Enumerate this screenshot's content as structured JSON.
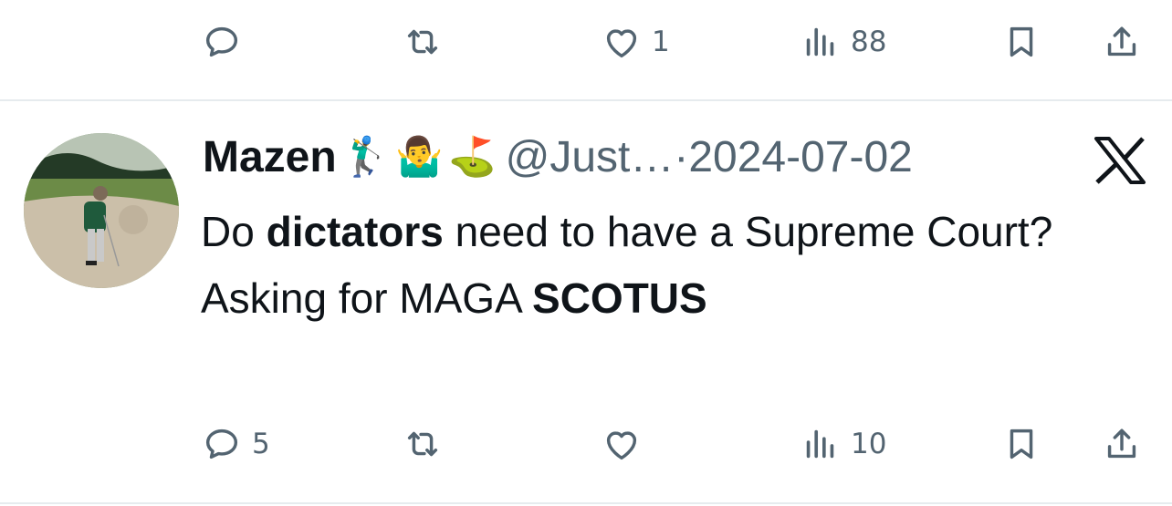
{
  "top_actions": {
    "reply_count": "",
    "retweet_count": "",
    "like_count": "1",
    "views_count": "88"
  },
  "tweet": {
    "author_name": "Mazen",
    "name_emojis": [
      "🏌️‍♂️",
      "🤷‍♂️",
      "⛳"
    ],
    "handle": "@Just…",
    "separator": "·",
    "date": "2024-07-02",
    "text": {
      "p1_before": "Do ",
      "p1_bold": "dictators",
      "p1_after": " need to have a Supreme Court?",
      "p2_before": "Asking for MAGA ",
      "p2_bold": "SCOTUS"
    },
    "actions": {
      "reply_count": "5",
      "retweet_count": "",
      "like_count": "",
      "views_count": "10"
    }
  },
  "icons": {
    "reply": "reply-icon",
    "retweet": "retweet-icon",
    "like": "heart-icon",
    "views": "views-icon",
    "bookmark": "bookmark-icon",
    "share": "share-icon",
    "platform": "x-logo-icon"
  },
  "colors": {
    "text": "#0f1419",
    "muted": "#536471",
    "divider": "#e6ebee"
  }
}
